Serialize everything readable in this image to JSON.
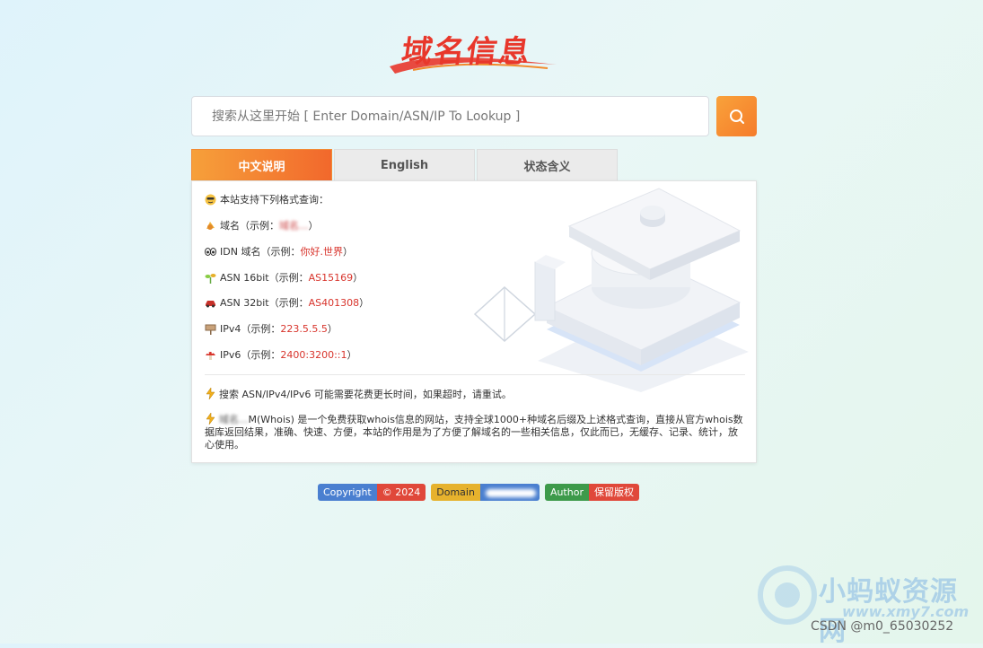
{
  "logo": {
    "text": "域名信息"
  },
  "search": {
    "placeholder": "搜索从这里开始 [ Enter Domain/ASN/IP To Lookup ]"
  },
  "tabs": [
    {
      "label": "中文说明",
      "active": true
    },
    {
      "label": "English",
      "active": false
    },
    {
      "label": "状态含义",
      "active": false
    }
  ],
  "panel": {
    "intro": "本站支持下列格式查询：",
    "rows": [
      {
        "icon": "cool-face-icon",
        "prefix": "域名（示例：",
        "example": "域名...",
        "suffix": "）"
      },
      {
        "icon": "eyes-icon",
        "prefix": "IDN 域名（示例：",
        "example": "你好.世界",
        "suffix": "）"
      },
      {
        "icon": "sprout-icon",
        "prefix": "ASN 16bit（示例：",
        "example": "AS15169",
        "suffix": "）"
      },
      {
        "icon": "car-icon",
        "prefix": "ASN 32bit（示例：",
        "example": "AS401308",
        "suffix": "）"
      },
      {
        "icon": "sign-icon",
        "prefix": "IPv4（示例：",
        "example": "223.5.5.5",
        "suffix": "）"
      },
      {
        "icon": "mushroom-icon",
        "prefix": "IPv6（示例：",
        "example": "2400:3200::1",
        "suffix": "）"
      }
    ],
    "note1": "搜索 ASN/IPv4/IPv6 可能需要花费更长时间，如果超时，请重试。",
    "note2_blur": "域名...",
    "note2": "M(Whois) 是一个免费获取whois信息的网站，支持全球1000+种域名后缀及上述格式查询，直接从官方whois数据库返回结果，准确、快速、方便，本站的作用是为了方便了解域名的一些相关信息，仅此而已，无缓存、记录、统计，放心使用。"
  },
  "footer": {
    "badges": [
      {
        "left": "Copyright",
        "right": "© 2024",
        "left_color": "#4a7fd0",
        "right_color": "#e0483a"
      },
      {
        "left": "Domain",
        "right": "",
        "left_color": "#e6b22d",
        "right_color": "#4a7fd0"
      },
      {
        "left": "Author",
        "right": "保留版权",
        "left_color": "#3d9a4a",
        "right_color": "#e0483a"
      }
    ]
  },
  "watermark": {
    "brand": "小蚂蚁资源网",
    "url": "www.xmy7.com"
  },
  "csdn": "CSDN @m0_65030252",
  "colors": {
    "accent": "#f57c2a",
    "example": "#d8342c"
  }
}
